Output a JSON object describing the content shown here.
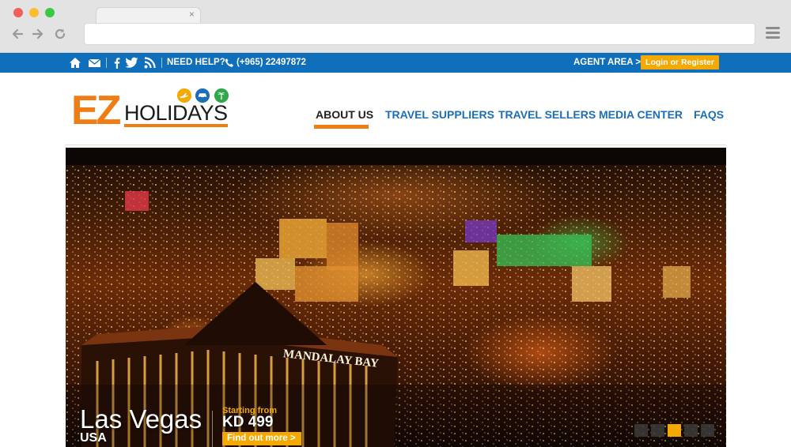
{
  "browser": {
    "tab_close": "×",
    "icons": {
      "back": "back-arrow-icon",
      "forward": "forward-arrow-icon",
      "reload": "reload-icon",
      "menu": "hamburger-menu-icon"
    }
  },
  "topbar": {
    "need_help": "NEED HELP?",
    "phone": "(+965) 22497872",
    "agent_area": "AGENT AREA >",
    "login_register": "Login or Register",
    "icons": [
      "home-icon",
      "mail-icon",
      "facebook-icon",
      "twitter-icon",
      "rss-icon",
      "phone-icon"
    ],
    "bg_color": "#0f6fba"
  },
  "logo": {
    "ez": "EZ",
    "holidays": "HOLIDAYS",
    "brand_orange": "#f07d14"
  },
  "nav": {
    "items": [
      {
        "label": "ABOUT US",
        "active": true
      },
      {
        "label": "TRAVEL SUPPLIERS",
        "active": false
      },
      {
        "label": "TRAVEL SELLERS",
        "active": false
      },
      {
        "label": "MEDIA CENTER",
        "active": false
      },
      {
        "label": "FAQS",
        "active": false
      }
    ]
  },
  "hero": {
    "sign_text": "MANDALAY BAY",
    "city": "Las Vegas",
    "country": "USA",
    "starting_from": "Starting from",
    "price": "KD 499",
    "cta": "Find out more >",
    "slides": 5,
    "active_slide": 3,
    "accent": "#f5a800"
  }
}
